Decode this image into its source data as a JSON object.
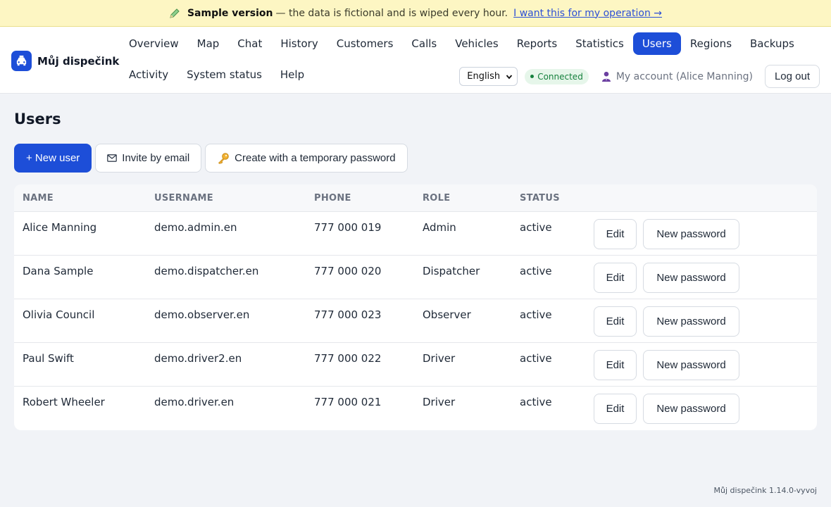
{
  "banner": {
    "strong": "Sample version",
    "text": "— the data is fictional and is wiped every hour.",
    "link": "I want this for my operation →"
  },
  "brand": {
    "name": "Můj dispečink"
  },
  "nav": {
    "row1": [
      "Overview",
      "Map",
      "Chat",
      "History",
      "Customers",
      "Calls",
      "Vehicles",
      "Reports",
      "Statistics",
      "Users",
      "Regions",
      "Backups"
    ],
    "row2": [
      "Activity",
      "System status",
      "Help"
    ],
    "active": "Users"
  },
  "tools": {
    "language": "English",
    "connection": "Connected",
    "account": "My account (Alice Manning)",
    "logout": "Log out"
  },
  "page": {
    "title": "Users"
  },
  "actions": {
    "new_user": "+ New user",
    "invite": "Invite by email",
    "temp_password": "Create with a temporary password"
  },
  "table": {
    "headers": {
      "name": "NAME",
      "username": "USERNAME",
      "phone": "PHONE",
      "role": "ROLE",
      "status": "STATUS"
    },
    "edit_label": "Edit",
    "new_password_label": "New password",
    "rows": [
      {
        "name": "Alice Manning",
        "username": "demo.admin.en",
        "phone": "777 000 019",
        "role": "Admin",
        "status": "active"
      },
      {
        "name": "Dana Sample",
        "username": "demo.dispatcher.en",
        "phone": "777 000 020",
        "role": "Dispatcher",
        "status": "active"
      },
      {
        "name": "Olivia Council",
        "username": "demo.observer.en",
        "phone": "777 000 023",
        "role": "Observer",
        "status": "active"
      },
      {
        "name": "Paul Swift",
        "username": "demo.driver2.en",
        "phone": "777 000 022",
        "role": "Driver",
        "status": "active"
      },
      {
        "name": "Robert Wheeler",
        "username": "demo.driver.en",
        "phone": "777 000 021",
        "role": "Driver",
        "status": "active"
      }
    ]
  },
  "footer": {
    "version": "Můj dispečink 1.14.0-vyvoj"
  },
  "colors": {
    "accent": "#1d4ed8",
    "banner_bg": "#fdf6c3",
    "connected": "#15803d"
  },
  "icons": [
    "pencil-icon",
    "taxi-icon",
    "chevron-down-icon",
    "user-icon",
    "mail-icon",
    "key-icon"
  ]
}
